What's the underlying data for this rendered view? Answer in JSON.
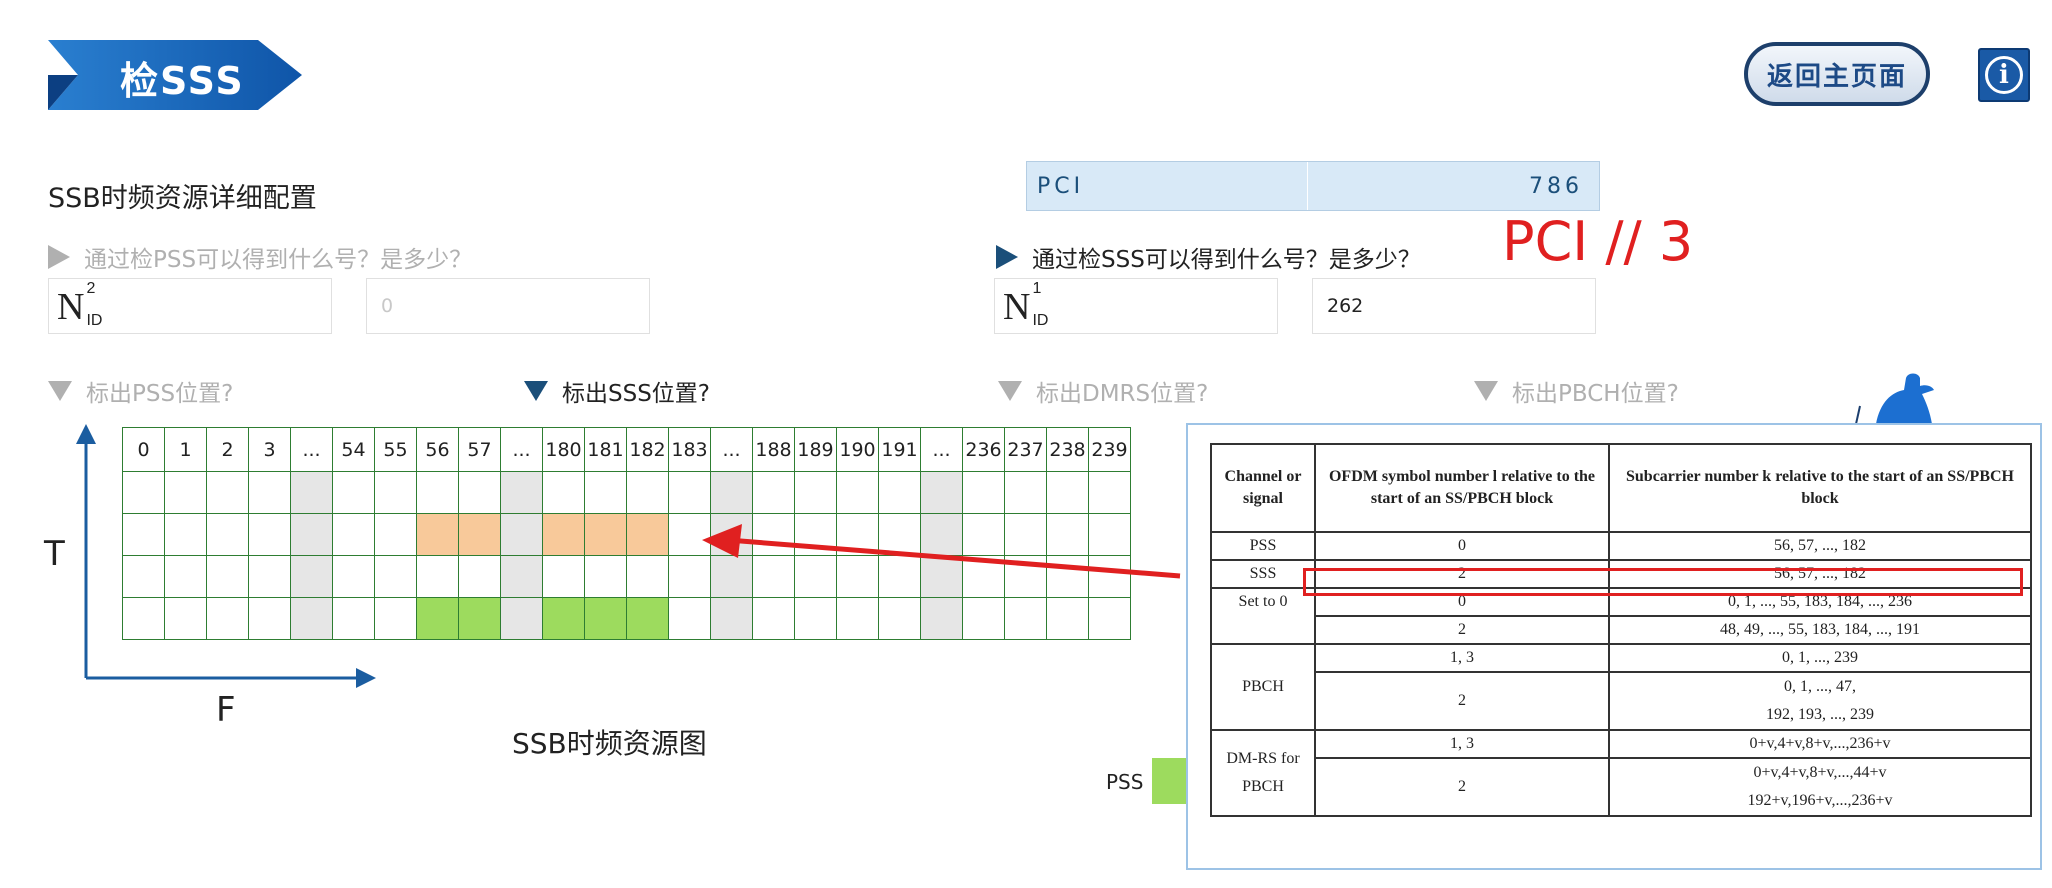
{
  "header": {
    "title": "检SSS",
    "home_button": "返回主页面"
  },
  "section_title": "SSB时频资源详细配置",
  "pci": {
    "label": "PCI",
    "value": "786"
  },
  "pci_note": "PCI // 3",
  "pss_question": {
    "text": "通过检PSS可以得到什么号？是多少？",
    "symbol": "N",
    "sup": "2",
    "sub": "ID",
    "value": "0"
  },
  "sss_question": {
    "text": "通过检SSS可以得到什么号？是多少？",
    "symbol": "N",
    "sup": "1",
    "sub": "ID",
    "value": "262"
  },
  "toggles": [
    {
      "label": "标出PSS位置?"
    },
    {
      "label": "标出SSS位置?"
    },
    {
      "label": "标出DMRS位置?"
    },
    {
      "label": "标出PBCH位置?"
    }
  ],
  "grid": {
    "headers": [
      "0",
      "1",
      "2",
      "3",
      "...",
      "54",
      "55",
      "56",
      "57",
      "...",
      "180",
      "181",
      "182",
      "183",
      "...",
      "188",
      "189",
      "190",
      "191",
      "...",
      "236",
      "237",
      "238",
      "239"
    ],
    "rows": [
      [
        "",
        "",
        "",
        "",
        "g",
        "",
        "",
        "",
        "",
        "g",
        "",
        "",
        "",
        "",
        "g",
        "",
        "",
        "",
        "",
        "g",
        "",
        "",
        "",
        ""
      ],
      [
        "",
        "",
        "",
        "",
        "g",
        "",
        "",
        "o",
        "o",
        "g",
        "o",
        "o",
        "o",
        "",
        "g",
        "",
        "",
        "",
        "",
        "g",
        "",
        "",
        "",
        ""
      ],
      [
        "",
        "",
        "",
        "",
        "g",
        "",
        "",
        "",
        "",
        "g",
        "",
        "",
        "",
        "",
        "g",
        "",
        "",
        "",
        "",
        "g",
        "",
        "",
        "",
        ""
      ],
      [
        "",
        "",
        "",
        "",
        "g",
        "",
        "",
        "n",
        "n",
        "g",
        "n",
        "n",
        "n",
        "",
        "g",
        "",
        "",
        "",
        "",
        "g",
        "",
        "",
        "",
        ""
      ]
    ],
    "axis_t": "T",
    "axis_f": "F",
    "caption": "SSB时频资源图"
  },
  "legend": {
    "pss": "PSS"
  },
  "ref_table": {
    "headers": [
      "Channel or signal",
      "OFDM symbol number l relative to the start of an SS/PBCH block",
      "Subcarrier number k relative to the start of an SS/PBCH block"
    ],
    "rows": [
      [
        "PSS",
        "0",
        "56, 57, ..., 182"
      ],
      [
        "SSS",
        "2",
        "56, 57, ..., 182"
      ],
      [
        "Set to 0",
        "0",
        "0, 1, ..., 55, 183, 184, ..., 236"
      ],
      [
        "",
        "2",
        "48, 49, ..., 55, 183, 184, ..., 191"
      ],
      [
        "PBCH",
        "1, 3",
        "0, 1, ..., 239"
      ],
      [
        "",
        "2",
        "0, 1, ..., 47,"
      ],
      [
        "",
        "",
        "192, 193, ..., 239"
      ],
      [
        "DM-RS for PBCH",
        "1, 3",
        "0+v,4+v,8+v,...,236+v"
      ],
      [
        "",
        "2",
        "0+v,4+v,8+v,...,44+v"
      ],
      [
        "",
        "",
        "192+v,196+v,...,236+v"
      ]
    ]
  }
}
